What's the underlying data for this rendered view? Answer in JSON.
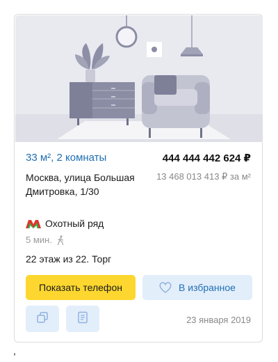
{
  "listing": {
    "title": "33 м², 2 комнаты",
    "price": "444 444 442 624 ₽",
    "price_per_sqm": "13 468 013 413 ₽ за м²",
    "address": "Москва, улица Большая Дмитровка, 1/30",
    "metro": {
      "station": "Охотный ряд",
      "icon": "metro-icon",
      "color": "#e0352b",
      "walk_time": "5 мин.",
      "walk_icon": "walking-person-icon"
    },
    "floor_info": "22 этаж из 22. Торг",
    "date": "23 января 2019"
  },
  "actions": {
    "show_phone": "Показать телефон",
    "add_favorite": "В избранное",
    "favorite_icon": "heart-icon",
    "compare_icon": "compare-icon",
    "note_icon": "note-icon"
  },
  "photo": {
    "image": "living-room-illustration"
  },
  "colors": {
    "link": "#1f6fb2",
    "phone_button": "#fdd72f",
    "secondary_button": "#e3eefb"
  },
  "stray_text": ","
}
